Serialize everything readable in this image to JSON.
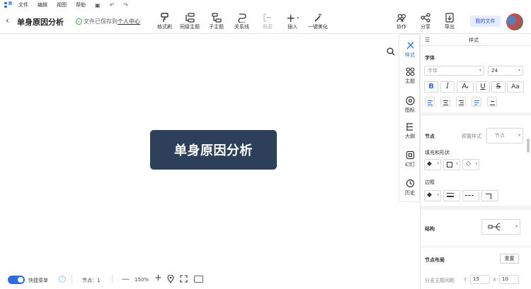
{
  "menu": {
    "items": [
      "文件",
      "编辑",
      "视图",
      "帮助"
    ]
  },
  "header": {
    "title": "单身原因分析",
    "save_status": "文件已保存到",
    "save_link": "个人中心"
  },
  "toolbar": {
    "items": [
      "格式刷",
      "同级主题",
      "子主题",
      "关系线",
      "概要",
      "插入",
      "一键美化"
    ],
    "right": [
      "协作",
      "分享",
      "导出"
    ],
    "my_files": "我的文件"
  },
  "canvas": {
    "root_text": "单身原因分析"
  },
  "side_tabs": [
    "样式",
    "主题",
    "图标",
    "大纲",
    "幻灯",
    "历史"
  ],
  "panel": {
    "title": "样式",
    "font_section": "字体",
    "font_family": "字体",
    "font_size": "24",
    "node_section": "节点",
    "preset_label": "预置样式",
    "preset_value": "节点",
    "fill_shape": "填充和形状",
    "border": "边框",
    "structure": "结构",
    "node_layout": "节点布局",
    "reset": "重置",
    "spacing_label": "分支主题间距",
    "y_label": "Y",
    "y_value": "15",
    "x_label": "X",
    "x_value": "10"
  },
  "bottom": {
    "quick_menu": "快捷菜单",
    "nodes_label": "节点：1",
    "zoom": "150%"
  },
  "colors": {
    "accent": "#2b6de0",
    "root_node": "#2e4059"
  }
}
